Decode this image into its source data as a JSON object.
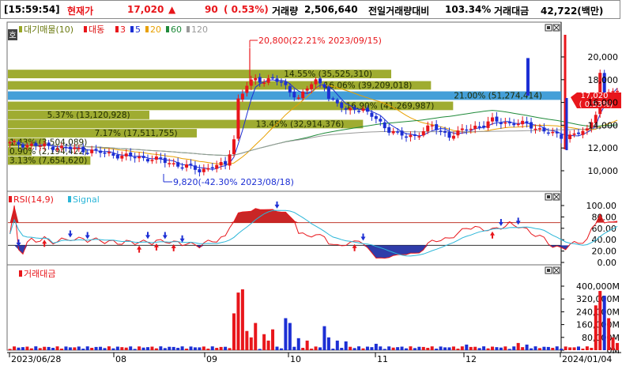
{
  "header": {
    "time": "[15:59:54]",
    "price_label": "현재가",
    "price": "17,020",
    "up_arrow": "▲",
    "change": "90",
    "change_pct": "( 0.53%)",
    "volume_label": "거래량",
    "volume": "2,506,640",
    "prev_ratio_label": "전일거래량대비",
    "prev_ratio": "103.34%",
    "amount_label": "거래대금",
    "amount": "42,722(백만)"
  },
  "colors": {
    "up": "#e8161b",
    "down": "#1c2fd4",
    "orderbar_green": "#9aa826",
    "orderbar_blue": "#3a9ad6"
  },
  "price_panel": {
    "legend": {
      "orderbar": "대기매물(10)",
      "ma_name": "대동",
      "ma_periods": [
        "3",
        "5",
        "20",
        "60",
        "120"
      ]
    },
    "side_label": "호",
    "current_price_tag": "17,020",
    "current_pct_tag": "( 0.53%)",
    "high_annotation": "20,800(22.21% 2023/09/15)",
    "low_annotation": "9,820(-42.30% 2023/08/18)"
  },
  "rsi_panel": {
    "label": "RSI(14,9)",
    "signal_label": "Signal"
  },
  "volume_panel": {
    "label": "거래대금"
  },
  "chart_data": [
    {
      "type": "candlestick",
      "y_ticks": [
        "20,000",
        "18,000",
        "16,000",
        "14,000",
        "12,000",
        "10,000"
      ],
      "ylim": [
        9000,
        21500
      ],
      "x_labels": [
        "2023/06/28",
        "08",
        "09",
        "10",
        "11",
        "12",
        "2024/01/04"
      ],
      "high": 20800,
      "low": 9820,
      "last": 17020,
      "order_bars": [
        {
          "price": 18500,
          "label": "14.55% (35,525,310)",
          "pct": 14.55
        },
        {
          "price": 17500,
          "label": "16.06% (39,209,018)",
          "pct": 16.06
        },
        {
          "price": 16600,
          "label": "21.00% (51,274,414)",
          "pct": 21.0
        },
        {
          "price": 15700,
          "label": "16.90% (41,269,987)",
          "pct": 16.9
        },
        {
          "price": 14900,
          "label": "5.37% (13,120,928)",
          "pct": 5.37
        },
        {
          "price": 14100,
          "label": "13.48% (32,914,376)",
          "pct": 13.48
        },
        {
          "price": 13300,
          "label": "7.17% (17,511,755)",
          "pct": 7.17
        },
        {
          "price": 12500,
          "label": "1.43% (3,504,089)",
          "pct": 1.43
        },
        {
          "price": 11700,
          "label": "0.90% (2,194,422)",
          "pct": 0.9
        },
        {
          "price": 10900,
          "label": "3.13% (7,654,620)",
          "pct": 3.13
        }
      ]
    },
    {
      "type": "line",
      "series": [
        {
          "name": "RSI(14,9)"
        },
        {
          "name": "Signal"
        }
      ],
      "y_ticks": [
        "100.00",
        "80.00",
        "60.00",
        "40.00",
        "20.00",
        "0.00"
      ],
      "ylim": [
        0,
        100
      ],
      "levels": [
        70,
        30
      ]
    },
    {
      "type": "bar",
      "series": [
        {
          "name": "거래대금"
        }
      ],
      "y_ticks": [
        "400,000M",
        "320,000M",
        "240,000M",
        "160,000M",
        "80,000M",
        "0M"
      ],
      "ylim": [
        0,
        420000
      ]
    }
  ]
}
